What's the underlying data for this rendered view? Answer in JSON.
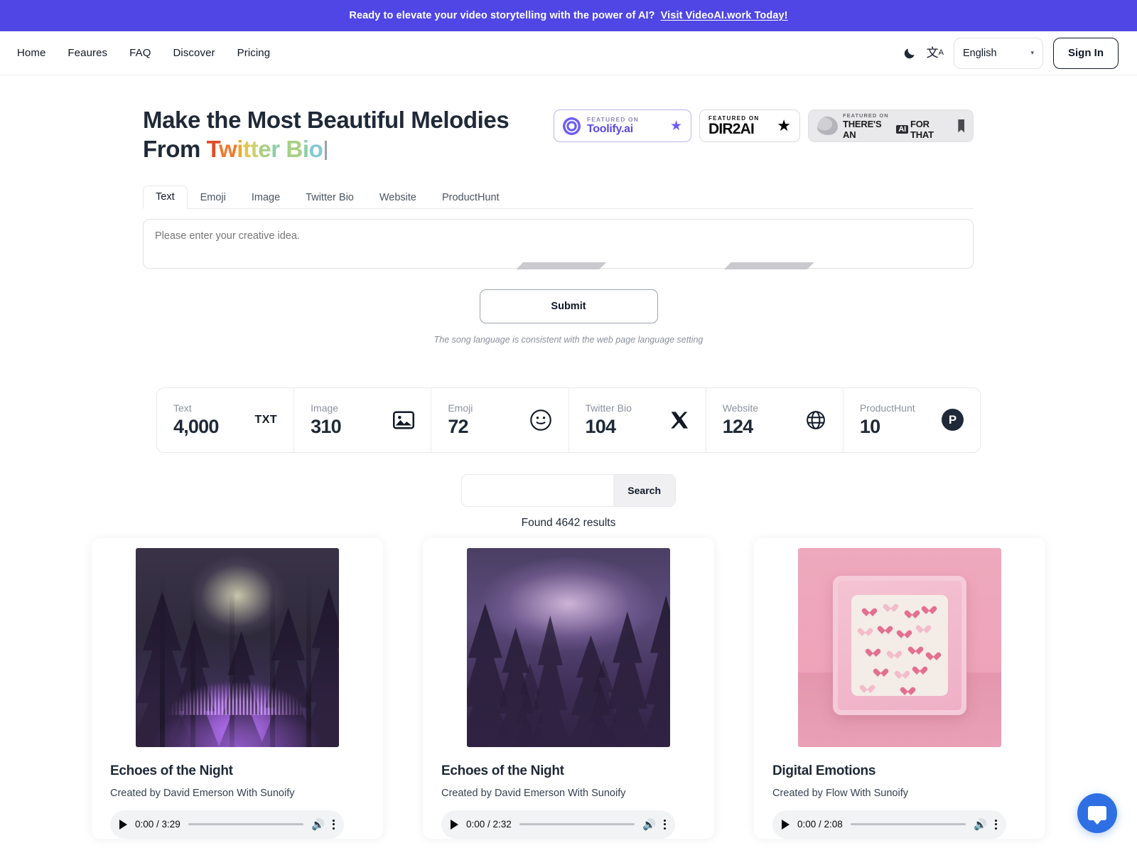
{
  "promo": {
    "text": "Ready to elevate your video storytelling with the power of AI?",
    "link_label": "Visit VideoAI.work Today!",
    "bg_color": "#4f46e5"
  },
  "nav": {
    "links": [
      {
        "label": "Home"
      },
      {
        "label": "Feaures"
      },
      {
        "label": "FAQ"
      },
      {
        "label": "Discover"
      },
      {
        "label": "Pricing"
      }
    ],
    "dark_mode_icon": "moon-icon",
    "translate_icon": "translate-icon",
    "language": {
      "selected": "English",
      "caret": "▾"
    },
    "sign_in_label": "Sign In"
  },
  "hero": {
    "title_line1": "Make the Most Beautiful Melodies",
    "title_line2_prefix": "From ",
    "gradient_word": "Twitter Bio",
    "badges": [
      {
        "name": "toolify",
        "featured_label": "FEATURED ON",
        "brand": "Toolify.ai",
        "icon": "star-icon",
        "color": "#5b4ae0"
      },
      {
        "name": "dir2ai",
        "featured_label": "FEATURED ON",
        "brand": "DIR2AI",
        "icon": "star-icon",
        "color": "#000000"
      },
      {
        "name": "theres-an-ai-for-that",
        "featured_label": "FEATURED ON",
        "brand_part1": "THERE'S AN",
        "brand_chip": "AI",
        "brand_part2": "FOR THAT",
        "icon": "bookmark-icon",
        "color": "#4a4a50"
      }
    ]
  },
  "generator": {
    "tabs": [
      {
        "label": "Text",
        "active": true
      },
      {
        "label": "Emoji",
        "active": false
      },
      {
        "label": "Image",
        "active": false
      },
      {
        "label": "Twitter Bio",
        "active": false
      },
      {
        "label": "Website",
        "active": false
      },
      {
        "label": "ProductHunt",
        "active": false
      }
    ],
    "textarea": {
      "value": "",
      "placeholder": "Please enter your creative idea."
    },
    "submit_label": "Submit",
    "note": "The song language is consistent with the web page language setting"
  },
  "stats": [
    {
      "label": "Text",
      "value": "4,000",
      "icon": "txt-icon"
    },
    {
      "label": "Image",
      "value": "310",
      "icon": "picture-icon"
    },
    {
      "label": "Emoji",
      "value": "72",
      "icon": "smiley-icon"
    },
    {
      "label": "Twitter Bio",
      "value": "104",
      "icon": "x-twitter-icon"
    },
    {
      "label": "Website",
      "value": "124",
      "icon": "globe-icon"
    },
    {
      "label": "ProductHunt",
      "value": "10",
      "icon": "producthunt-icon"
    }
  ],
  "search": {
    "value": "",
    "placeholder": "",
    "button_label": "Search",
    "results_text": "Found 4642 results"
  },
  "cards": [
    {
      "title": "Echoes of the Night",
      "creator": "Created by David Emerson With Sunoify",
      "artwork": "dark-forest-purple-waveform",
      "player": {
        "current_time": "0:00",
        "duration": "3:29",
        "time_display": "0:00 / 3:29",
        "progress_pct": 0
      }
    },
    {
      "title": "Echoes of the Night",
      "creator": "Created by David Emerson With Sunoify",
      "artwork": "purple-pine-forest-mist",
      "player": {
        "current_time": "0:00",
        "duration": "2:32",
        "time_display": "0:00 / 2:32",
        "progress_pct": 0
      }
    },
    {
      "title": "Digital Emotions",
      "creator": "Created by Flow With Sunoify",
      "artwork": "pink-hearts-frame",
      "player": {
        "current_time": "0:00",
        "duration": "2:08",
        "time_display": "0:00 / 2:08",
        "progress_pct": 0
      }
    }
  ],
  "chat_widget": {
    "icon": "chat-bubble-icon",
    "color": "#2f6fe4"
  }
}
